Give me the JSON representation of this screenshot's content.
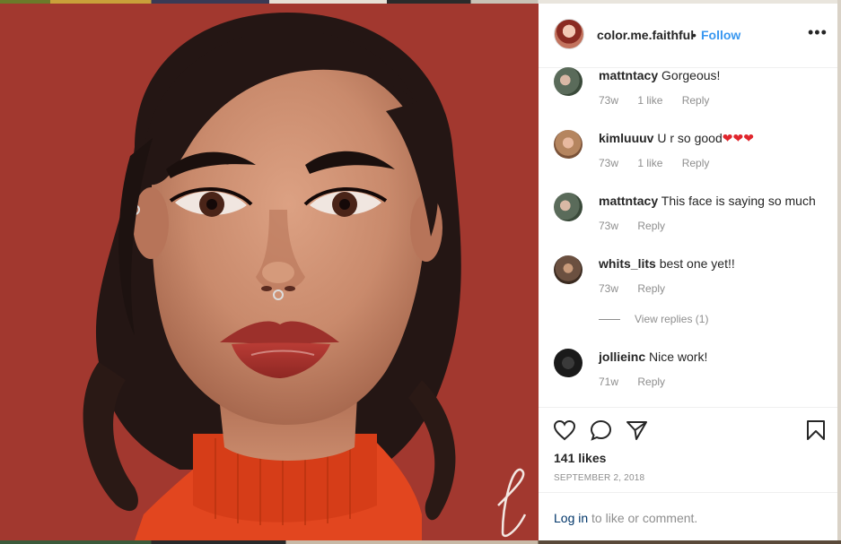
{
  "post": {
    "username": "color.me.faithful",
    "separator": "•",
    "follow_label": "Follow",
    "more_label": "•••"
  },
  "comments": [
    {
      "user": "mattntacy",
      "text": "Gorgeous!",
      "age": "73w",
      "likes": "1 like",
      "reply": "Reply"
    },
    {
      "user": "kimluuuv",
      "text": "U r so good",
      "hearts": "❤❤❤",
      "age": "73w",
      "likes": "1 like",
      "reply": "Reply"
    },
    {
      "user": "mattntacy",
      "text": "This face is saying so much",
      "age": "73w",
      "reply": "Reply"
    },
    {
      "user": "whits_lits",
      "text": "best one yet!!",
      "age": "73w",
      "reply": "Reply"
    },
    {
      "user": "jollieinc",
      "text": "Nice work!",
      "age": "71w",
      "reply": "Reply"
    }
  ],
  "view_replies": "View replies (1)",
  "likes": "141 likes",
  "date": "SEPTEMBER 2, 2018",
  "login": {
    "link": "Log in",
    "rest": " to like or comment."
  },
  "colors": {
    "accent": "#3897f0",
    "background": "#a2382f",
    "sweater": "#e2461f"
  },
  "icons": [
    "heart-icon",
    "comment-icon",
    "share-icon",
    "bookmark-icon",
    "more-options-icon"
  ]
}
